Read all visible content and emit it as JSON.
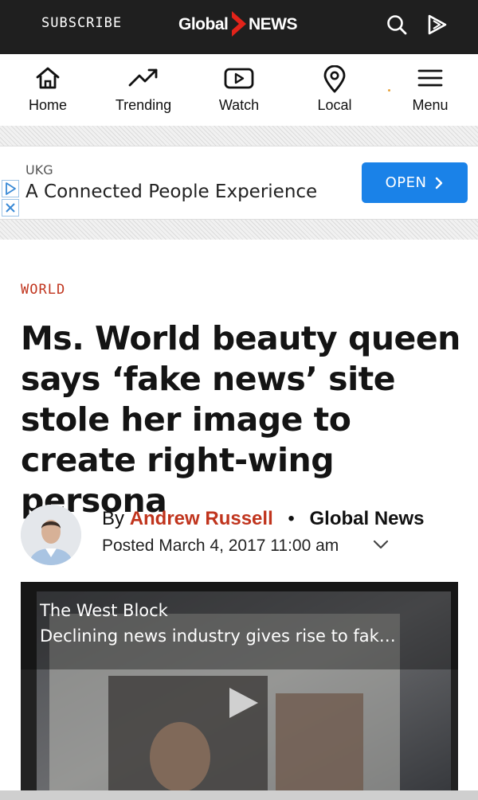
{
  "header": {
    "subscribe_label": "SUBSCRIBE",
    "logo_text_left": "Global",
    "logo_text_right": "NEWS",
    "brand_color": "#e2231a"
  },
  "nav": {
    "items": [
      {
        "label": "Home",
        "icon": "home-icon"
      },
      {
        "label": "Trending",
        "icon": "trending-icon"
      },
      {
        "label": "Watch",
        "icon": "play-icon"
      },
      {
        "label": "Local",
        "icon": "location-pin-icon"
      },
      {
        "label": "Menu",
        "icon": "hamburger-menu-icon"
      }
    ]
  },
  "ad": {
    "brand": "UKG",
    "title": "A Connected People Experience",
    "button_label": "OPEN",
    "button_color": "#1a82e8"
  },
  "article": {
    "section": "WORLD",
    "headline": "Ms. World beauty queen says ‘fake news’ site stole her image to create right-wing persona",
    "by_prefix": "By",
    "author": "Andrew Russell",
    "separator": "•",
    "publisher": "Global News",
    "posted": "Posted March 4, 2017 11:00 am",
    "accent_color": "#c0341d"
  },
  "video": {
    "show": "The West Block",
    "title": "Declining news industry gives rise to fak…"
  }
}
